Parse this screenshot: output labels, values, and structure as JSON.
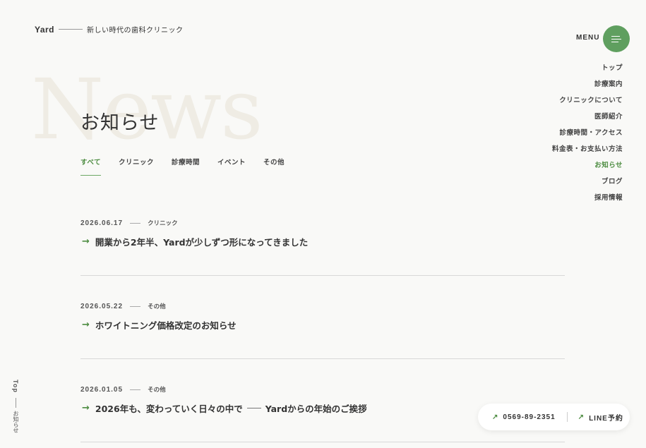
{
  "header": {
    "brand": "Yard",
    "tagline": "新しい時代の歯科クリニック",
    "menu_label": "MENU"
  },
  "nav": [
    {
      "label": "トップ"
    },
    {
      "label": "診療案内"
    },
    {
      "label": "クリニックについて"
    },
    {
      "label": "医師紹介"
    },
    {
      "label": "診療時間・アクセス"
    },
    {
      "label": "料金表・お支払い方法"
    },
    {
      "label": "お知らせ",
      "active": true
    },
    {
      "label": "ブログ"
    },
    {
      "label": "採用情報"
    }
  ],
  "page": {
    "bg_word": "News",
    "title": "お知らせ"
  },
  "tabs": [
    {
      "label": "すべて",
      "active": true
    },
    {
      "label": "クリニック"
    },
    {
      "label": "診療時間"
    },
    {
      "label": "イベント"
    },
    {
      "label": "その他"
    }
  ],
  "news": [
    {
      "date": "2026.06.17",
      "category": "クリニック",
      "title": "開業から2年半、Yardが少しずつ形になってきました",
      "subtitle": ""
    },
    {
      "date": "2026.05.22",
      "category": "その他",
      "title": "ホワイトニング価格改定のお知らせ",
      "subtitle": ""
    },
    {
      "date": "2026.01.05",
      "category": "その他",
      "title": "2026年も、変わっていく日々の中で",
      "subtitle": "Yardからの年始のご挨拶"
    }
  ],
  "side": {
    "top_label": "Top",
    "current_label": "お知らせ"
  },
  "contact": {
    "phone": "0569-89-2351",
    "line": "LINE予約"
  },
  "colors": {
    "accent": "#5f9f5f",
    "accent_text": "#4e8d42",
    "background": "#f9f9f7"
  },
  "icons": {
    "arrow": "arrow-right-icon",
    "external": "arrow-up-right-icon",
    "menu": "hamburger-icon"
  }
}
